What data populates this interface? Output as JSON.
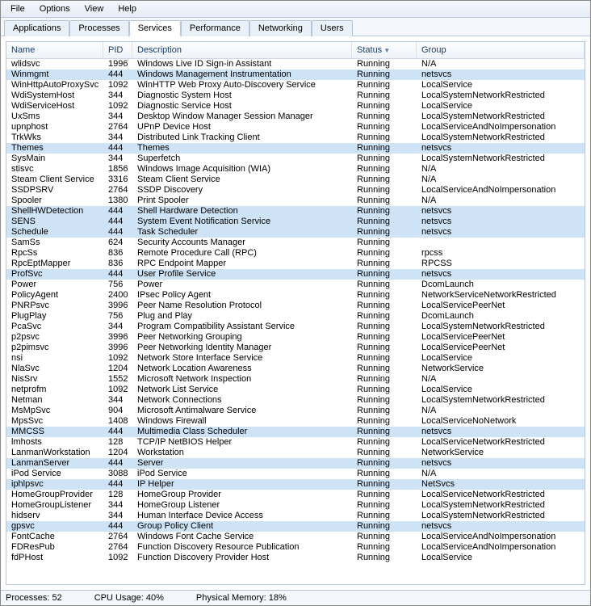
{
  "menu": [
    "File",
    "Options",
    "View",
    "Help"
  ],
  "tabs": [
    "Applications",
    "Processes",
    "Services",
    "Performance",
    "Networking",
    "Users"
  ],
  "active_tab": 2,
  "columns": [
    "Name",
    "PID",
    "Description",
    "Status",
    "Group"
  ],
  "sort_column": 3,
  "status": {
    "processes": "Processes: 52",
    "cpu": "CPU Usage: 40%",
    "mem": "Physical Memory: 18%"
  },
  "rows": [
    {
      "name": "wlidsvc",
      "pid": "1996",
      "desc": "Windows Live ID Sign-in Assistant",
      "stat": "Running",
      "group": "N/A",
      "sel": false
    },
    {
      "name": "Winmgmt",
      "pid": "444",
      "desc": "Windows Management Instrumentation",
      "stat": "Running",
      "group": "netsvcs",
      "sel": true
    },
    {
      "name": "WinHttpAutoProxySvc",
      "pid": "1092",
      "desc": "WinHTTP Web Proxy Auto-Discovery Service",
      "stat": "Running",
      "group": "LocalService",
      "sel": false
    },
    {
      "name": "WdiSystemHost",
      "pid": "344",
      "desc": "Diagnostic System Host",
      "stat": "Running",
      "group": "LocalSystemNetworkRestricted",
      "sel": false
    },
    {
      "name": "WdiServiceHost",
      "pid": "1092",
      "desc": "Diagnostic Service Host",
      "stat": "Running",
      "group": "LocalService",
      "sel": false
    },
    {
      "name": "UxSms",
      "pid": "344",
      "desc": "Desktop Window Manager Session Manager",
      "stat": "Running",
      "group": "LocalSystemNetworkRestricted",
      "sel": false
    },
    {
      "name": "upnphost",
      "pid": "2764",
      "desc": "UPnP Device Host",
      "stat": "Running",
      "group": "LocalServiceAndNoImpersonation",
      "sel": false
    },
    {
      "name": "TrkWks",
      "pid": "344",
      "desc": "Distributed Link Tracking Client",
      "stat": "Running",
      "group": "LocalSystemNetworkRestricted",
      "sel": false
    },
    {
      "name": "Themes",
      "pid": "444",
      "desc": "Themes",
      "stat": "Running",
      "group": "netsvcs",
      "sel": true
    },
    {
      "name": "SysMain",
      "pid": "344",
      "desc": "Superfetch",
      "stat": "Running",
      "group": "LocalSystemNetworkRestricted",
      "sel": false
    },
    {
      "name": "stisvc",
      "pid": "1856",
      "desc": "Windows Image Acquisition (WIA)",
      "stat": "Running",
      "group": "N/A",
      "sel": false
    },
    {
      "name": "Steam Client Service",
      "pid": "3316",
      "desc": "Steam Client Service",
      "stat": "Running",
      "group": "N/A",
      "sel": false
    },
    {
      "name": "SSDPSRV",
      "pid": "2764",
      "desc": "SSDP Discovery",
      "stat": "Running",
      "group": "LocalServiceAndNoImpersonation",
      "sel": false
    },
    {
      "name": "Spooler",
      "pid": "1380",
      "desc": "Print Spooler",
      "stat": "Running",
      "group": "N/A",
      "sel": false
    },
    {
      "name": "ShellHWDetection",
      "pid": "444",
      "desc": "Shell Hardware Detection",
      "stat": "Running",
      "group": "netsvcs",
      "sel": true
    },
    {
      "name": "SENS",
      "pid": "444",
      "desc": "System Event Notification Service",
      "stat": "Running",
      "group": "netsvcs",
      "sel": true
    },
    {
      "name": "Schedule",
      "pid": "444",
      "desc": "Task Scheduler",
      "stat": "Running",
      "group": "netsvcs",
      "sel": true
    },
    {
      "name": "SamSs",
      "pid": "624",
      "desc": "Security Accounts Manager",
      "stat": "Running",
      "group": "",
      "sel": false
    },
    {
      "name": "RpcSs",
      "pid": "836",
      "desc": "Remote Procedure Call (RPC)",
      "stat": "Running",
      "group": "rpcss",
      "sel": false
    },
    {
      "name": "RpcEptMapper",
      "pid": "836",
      "desc": "RPC Endpoint Mapper",
      "stat": "Running",
      "group": "RPCSS",
      "sel": false
    },
    {
      "name": "ProfSvc",
      "pid": "444",
      "desc": "User Profile Service",
      "stat": "Running",
      "group": "netsvcs",
      "sel": true
    },
    {
      "name": "Power",
      "pid": "756",
      "desc": "Power",
      "stat": "Running",
      "group": "DcomLaunch",
      "sel": false
    },
    {
      "name": "PolicyAgent",
      "pid": "2400",
      "desc": "IPsec Policy Agent",
      "stat": "Running",
      "group": "NetworkServiceNetworkRestricted",
      "sel": false
    },
    {
      "name": "PNRPsvc",
      "pid": "3996",
      "desc": "Peer Name Resolution Protocol",
      "stat": "Running",
      "group": "LocalServicePeerNet",
      "sel": false
    },
    {
      "name": "PlugPlay",
      "pid": "756",
      "desc": "Plug and Play",
      "stat": "Running",
      "group": "DcomLaunch",
      "sel": false
    },
    {
      "name": "PcaSvc",
      "pid": "344",
      "desc": "Program Compatibility Assistant Service",
      "stat": "Running",
      "group": "LocalSystemNetworkRestricted",
      "sel": false
    },
    {
      "name": "p2psvc",
      "pid": "3996",
      "desc": "Peer Networking Grouping",
      "stat": "Running",
      "group": "LocalServicePeerNet",
      "sel": false
    },
    {
      "name": "p2pimsvc",
      "pid": "3996",
      "desc": "Peer Networking Identity Manager",
      "stat": "Running",
      "group": "LocalServicePeerNet",
      "sel": false
    },
    {
      "name": "nsi",
      "pid": "1092",
      "desc": "Network Store Interface Service",
      "stat": "Running",
      "group": "LocalService",
      "sel": false
    },
    {
      "name": "NlaSvc",
      "pid": "1204",
      "desc": "Network Location Awareness",
      "stat": "Running",
      "group": "NetworkService",
      "sel": false
    },
    {
      "name": "NisSrv",
      "pid": "1552",
      "desc": "Microsoft Network Inspection",
      "stat": "Running",
      "group": "N/A",
      "sel": false
    },
    {
      "name": "netprofm",
      "pid": "1092",
      "desc": "Network List Service",
      "stat": "Running",
      "group": "LocalService",
      "sel": false
    },
    {
      "name": "Netman",
      "pid": "344",
      "desc": "Network Connections",
      "stat": "Running",
      "group": "LocalSystemNetworkRestricted",
      "sel": false
    },
    {
      "name": "MsMpSvc",
      "pid": "904",
      "desc": "Microsoft Antimalware Service",
      "stat": "Running",
      "group": "N/A",
      "sel": false
    },
    {
      "name": "MpsSvc",
      "pid": "1408",
      "desc": "Windows Firewall",
      "stat": "Running",
      "group": "LocalServiceNoNetwork",
      "sel": false
    },
    {
      "name": "MMCSS",
      "pid": "444",
      "desc": "Multimedia Class Scheduler",
      "stat": "Running",
      "group": "netsvcs",
      "sel": true
    },
    {
      "name": "lmhosts",
      "pid": "128",
      "desc": "TCP/IP NetBIOS Helper",
      "stat": "Running",
      "group": "LocalServiceNetworkRestricted",
      "sel": false
    },
    {
      "name": "LanmanWorkstation",
      "pid": "1204",
      "desc": "Workstation",
      "stat": "Running",
      "group": "NetworkService",
      "sel": false
    },
    {
      "name": "LanmanServer",
      "pid": "444",
      "desc": "Server",
      "stat": "Running",
      "group": "netsvcs",
      "sel": true
    },
    {
      "name": "iPod Service",
      "pid": "3088",
      "desc": "iPod Service",
      "stat": "Running",
      "group": "N/A",
      "sel": false
    },
    {
      "name": "iphlpsvc",
      "pid": "444",
      "desc": "IP Helper",
      "stat": "Running",
      "group": "NetSvcs",
      "sel": true
    },
    {
      "name": "HomeGroupProvider",
      "pid": "128",
      "desc": "HomeGroup Provider",
      "stat": "Running",
      "group": "LocalServiceNetworkRestricted",
      "sel": false
    },
    {
      "name": "HomeGroupListener",
      "pid": "344",
      "desc": "HomeGroup Listener",
      "stat": "Running",
      "group": "LocalSystemNetworkRestricted",
      "sel": false
    },
    {
      "name": "hidserv",
      "pid": "344",
      "desc": "Human Interface Device Access",
      "stat": "Running",
      "group": "LocalSystemNetworkRestricted",
      "sel": false
    },
    {
      "name": "gpsvc",
      "pid": "444",
      "desc": "Group Policy Client",
      "stat": "Running",
      "group": "netsvcs",
      "sel": true
    },
    {
      "name": "FontCache",
      "pid": "2764",
      "desc": "Windows Font Cache Service",
      "stat": "Running",
      "group": "LocalServiceAndNoImpersonation",
      "sel": false
    },
    {
      "name": "FDResPub",
      "pid": "2764",
      "desc": "Function Discovery Resource Publication",
      "stat": "Running",
      "group": "LocalServiceAndNoImpersonation",
      "sel": false
    },
    {
      "name": "fdPHost",
      "pid": "1092",
      "desc": "Function Discovery Provider Host",
      "stat": "Running",
      "group": "LocalService",
      "sel": false
    }
  ]
}
